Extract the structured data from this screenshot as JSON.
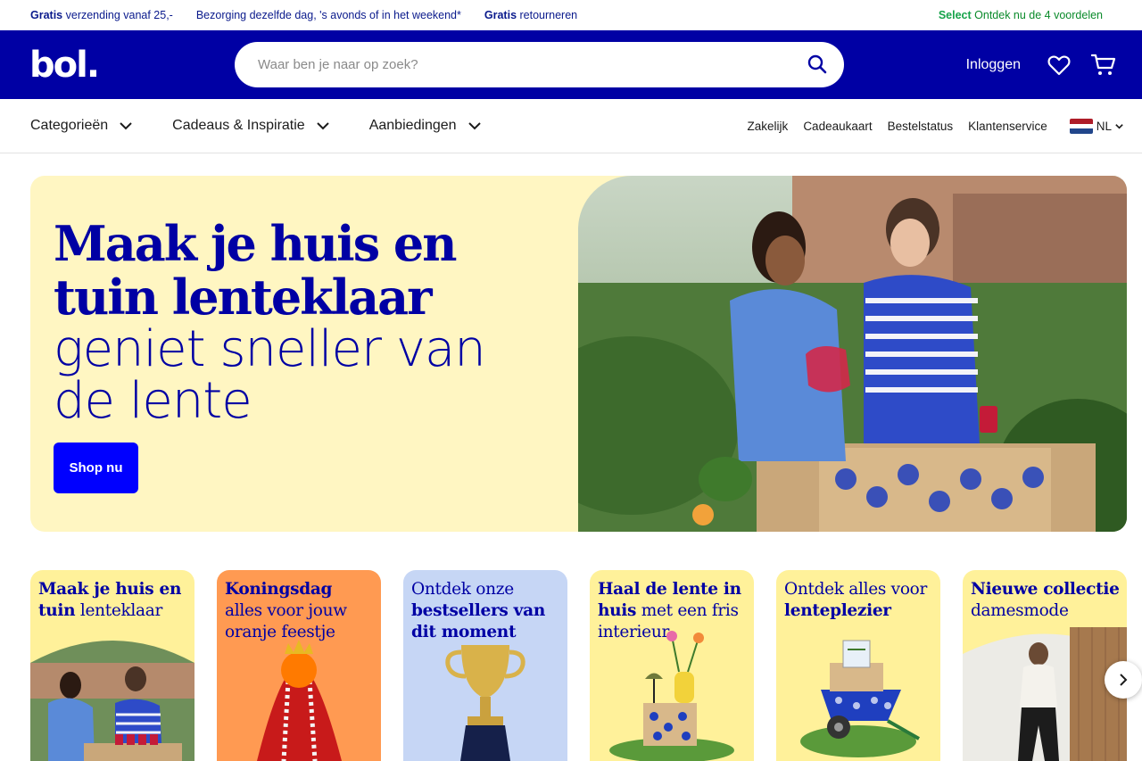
{
  "usp": {
    "item1": {
      "bold": "Gratis",
      "text": " verzending vanaf 25,-"
    },
    "item2": {
      "text": "Bezorging dezelfde dag, 's avonds of in het weekend*"
    },
    "item3": {
      "bold": "Gratis",
      "text": " retourneren"
    },
    "select": {
      "bold": "Select",
      "text": " Ontdek nu de 4 voordelen"
    }
  },
  "header": {
    "logo": "bol.",
    "search_placeholder": "Waar ben je naar op zoek?",
    "login": "Inloggen",
    "icons": [
      "search-icon",
      "heart-icon",
      "cart-icon"
    ],
    "brand_color": "#0000a4"
  },
  "nav": {
    "menus": [
      "Categorieën",
      "Cadeaus & Inspiratie",
      "Aanbiedingen"
    ],
    "links": [
      "Zakelijk",
      "Cadeaukaart",
      "Bestelstatus",
      "Klantenservice"
    ],
    "language": "NL"
  },
  "hero": {
    "title_line1": "Maak je huis en",
    "title_line2": "tuin lenteklaar",
    "sub_line1": "geniet sneller van",
    "sub_line2": "de lente",
    "cta": "Shop nu",
    "bg_color": "#fff6c2"
  },
  "tiles": [
    {
      "bold": "Maak je huis en tuin",
      "light": " lenteklaar",
      "color": "#fff19a"
    },
    {
      "bold": "Koningsdag",
      "light": " alles voor jouw oranje feestje",
      "color": "#ff9a52"
    },
    {
      "light": "Ontdek onze ",
      "bold": "bestsellers van dit moment",
      "color": "#c6d6f5"
    },
    {
      "bold": "Haal de lente in huis",
      "light": " met een fris interieur",
      "color": "#fff19a"
    },
    {
      "light": "Ontdek alles voor ",
      "bold": "lenteplezier",
      "color": "#fff19a"
    },
    {
      "bold": "Nieuwe collectie",
      "light": " damesmode",
      "color": "#fff19a"
    }
  ]
}
